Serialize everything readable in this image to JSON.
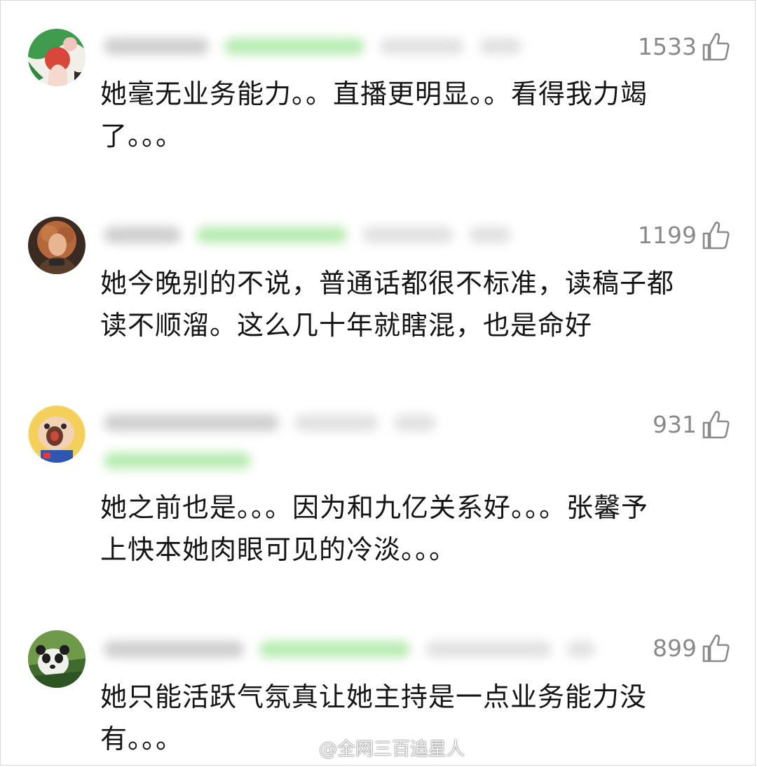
{
  "comments": [
    {
      "likes": "1533",
      "text": "她毫无业务能力。。直播更明显。。看得我力竭\n了。。。",
      "avatar": "avatar-green-figure"
    },
    {
      "likes": "1199",
      "text": "她今晚别的不说，普通话都很不标准，读稿子都\n读不顺溜。这么几十年就瞎混，也是命好",
      "avatar": "avatar-curly-hair-person"
    },
    {
      "likes": "931",
      "text": "她之前也是。。。因为和九亿关系好。。。张馨予\n上快本她肉眼可见的冷淡。。。",
      "avatar": "avatar-cartoon-character"
    },
    {
      "likes": "899",
      "text": "她只能活跃气氛真让她主持是一点业务能力没\n有。。。",
      "avatar": "avatar-panda"
    }
  ],
  "watermark": {
    "text": "@全网三百追星人",
    "icon": "weibo-logo-icon"
  },
  "icons": {
    "like": "thumbs-up-icon"
  },
  "colors": {
    "text": "#151515",
    "like_count": "#8a8a8a",
    "name_blur": "#cfcfcf",
    "badge_blur": "#b9ecb3"
  }
}
